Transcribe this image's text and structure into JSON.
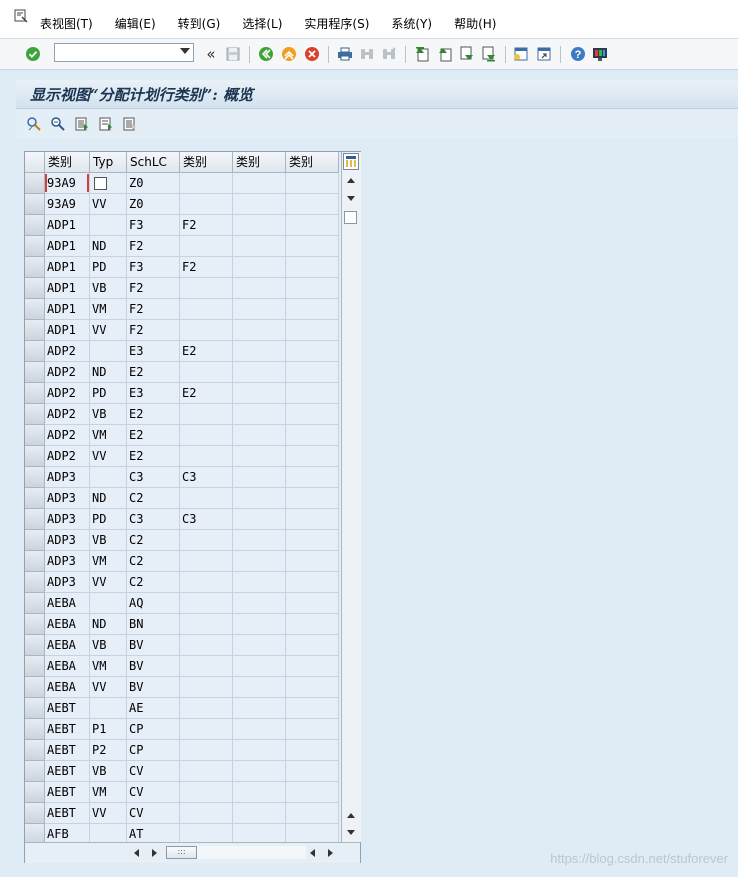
{
  "menu": {
    "items": [
      "表视图(T)",
      "编辑(E)",
      "转到(G)",
      "选择(L)",
      "实用程序(S)",
      "系统(Y)",
      "帮助(H)"
    ]
  },
  "toolbar": {
    "command_field_value": "",
    "icons": [
      "enter-icon",
      "save-icon",
      "back-icon",
      "exit-icon",
      "cancel-icon",
      "print-icon",
      "find-icon",
      "find-next-icon",
      "first-page-icon",
      "previous-page-icon",
      "next-page-icon",
      "last-page-icon",
      "create-session-icon",
      "shortcut-icon",
      "help-icon",
      "customize-layout-icon"
    ]
  },
  "title": "显示视图“分配计划行类别”: 概览",
  "app_toolbar": {
    "icons": [
      "display-change-icon",
      "details-icon",
      "select-all-icon",
      "select-block-icon",
      "deselect-all-icon"
    ]
  },
  "table": {
    "headers": [
      "类别",
      "Typ",
      "SchLC",
      "类别",
      "类别",
      "类别"
    ],
    "rows": [
      [
        "93A9",
        "",
        "Z0",
        "",
        "",
        ""
      ],
      [
        "93A9",
        "VV",
        "Z0",
        "",
        "",
        ""
      ],
      [
        "ADP1",
        "",
        "F3",
        "F2",
        "",
        ""
      ],
      [
        "ADP1",
        "ND",
        "F2",
        "",
        "",
        ""
      ],
      [
        "ADP1",
        "PD",
        "F3",
        "F2",
        "",
        ""
      ],
      [
        "ADP1",
        "VB",
        "F2",
        "",
        "",
        ""
      ],
      [
        "ADP1",
        "VM",
        "F2",
        "",
        "",
        ""
      ],
      [
        "ADP1",
        "VV",
        "F2",
        "",
        "",
        ""
      ],
      [
        "ADP2",
        "",
        "E3",
        "E2",
        "",
        ""
      ],
      [
        "ADP2",
        "ND",
        "E2",
        "",
        "",
        ""
      ],
      [
        "ADP2",
        "PD",
        "E3",
        "E2",
        "",
        ""
      ],
      [
        "ADP2",
        "VB",
        "E2",
        "",
        "",
        ""
      ],
      [
        "ADP2",
        "VM",
        "E2",
        "",
        "",
        ""
      ],
      [
        "ADP2",
        "VV",
        "E2",
        "",
        "",
        ""
      ],
      [
        "ADP3",
        "",
        "C3",
        "C3",
        "",
        ""
      ],
      [
        "ADP3",
        "ND",
        "C2",
        "",
        "",
        ""
      ],
      [
        "ADP3",
        "PD",
        "C3",
        "C3",
        "",
        ""
      ],
      [
        "ADP3",
        "VB",
        "C2",
        "",
        "",
        ""
      ],
      [
        "ADP3",
        "VM",
        "C2",
        "",
        "",
        ""
      ],
      [
        "ADP3",
        "VV",
        "C2",
        "",
        "",
        ""
      ],
      [
        "AEBA",
        "",
        "AQ",
        "",
        "",
        ""
      ],
      [
        "AEBA",
        "ND",
        "BN",
        "",
        "",
        ""
      ],
      [
        "AEBA",
        "VB",
        "BV",
        "",
        "",
        ""
      ],
      [
        "AEBA",
        "VM",
        "BV",
        "",
        "",
        ""
      ],
      [
        "AEBA",
        "VV",
        "BV",
        "",
        "",
        ""
      ],
      [
        "AEBT",
        "",
        "AE",
        "",
        "",
        ""
      ],
      [
        "AEBT",
        "P1",
        "CP",
        "",
        "",
        ""
      ],
      [
        "AEBT",
        "P2",
        "CP",
        "",
        "",
        ""
      ],
      [
        "AEBT",
        "VB",
        "CV",
        "",
        "",
        ""
      ],
      [
        "AEBT",
        "VM",
        "CV",
        "",
        "",
        ""
      ],
      [
        "AEBT",
        "VV",
        "CV",
        "",
        "",
        ""
      ],
      [
        "AFB",
        "",
        "AT",
        "",
        "",
        ""
      ]
    ]
  },
  "watermark": "https://blog.csdn.net/stuforever"
}
